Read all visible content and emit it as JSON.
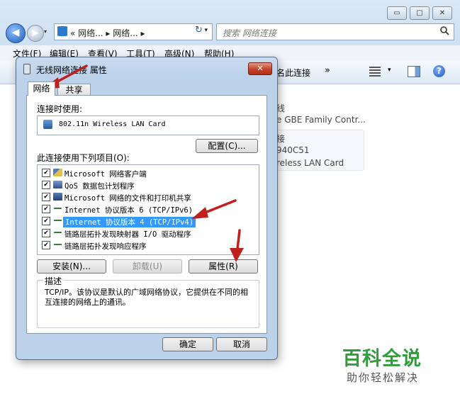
{
  "explorer": {
    "window_buttons": {
      "minimize": "▭",
      "maximize": "▢",
      "close": "✕"
    },
    "nav": {
      "back": "◀",
      "forward": "▶",
      "history": "▾"
    },
    "address_path": "« 网络... ▸ 网络... ▸",
    "address_dropdown": "▾",
    "refresh_icon": "↻",
    "search_placeholder": "搜索 网络连接",
    "menu": [
      "文件(F)",
      "编辑(E)",
      "查看(V)",
      "工具(T)",
      "高级(N)",
      "帮助(H)"
    ],
    "command_bar": {
      "rename": "名此连接",
      "more": "»",
      "view_dropdown": "▾",
      "help": "?"
    },
    "background_text": {
      "line1": "线",
      "line2": "e GBE Family Contr...",
      "line3": "接",
      "line4": "940C51",
      "line5": "reless LAN Card"
    }
  },
  "dialog": {
    "title": "无线网络连接 属性",
    "close": "✕",
    "tabs": {
      "network": "网络",
      "sharing": "共享"
    },
    "connect_using_label": "连接时使用:",
    "device_name": "802.11n Wireless LAN Card",
    "configure_button": "配置(C)...",
    "items_label": "此连接使用下列项目(O):",
    "items": [
      {
        "label": "Microsoft 网络客户端",
        "checked": true,
        "icon": "network-client-icon"
      },
      {
        "label": "QoS 数据包计划程序",
        "checked": true,
        "icon": "qos-icon"
      },
      {
        "label": "Microsoft 网络的文件和打印机共享",
        "checked": true,
        "icon": "file-share-icon"
      },
      {
        "label": "Internet 协议版本 6 (TCP/IPv6)",
        "checked": true,
        "icon": "protocol-icon"
      },
      {
        "label": "Internet 协议版本 4 (TCP/IPv4)",
        "checked": true,
        "icon": "protocol-icon",
        "selected": true
      },
      {
        "label": "链路层拓扑发现映射器 I/O 驱动程序",
        "checked": true,
        "icon": "protocol-icon"
      },
      {
        "label": "链路层拓扑发现响应程序",
        "checked": true,
        "icon": "protocol-icon"
      }
    ],
    "checkmark": "✔",
    "install_button": "安装(N)...",
    "uninstall_button": "卸载(U)",
    "properties_button": "属性(R)",
    "description_legend": "描述",
    "description_text": "TCP/IP。该协议是默认的广域网络协议，它提供在不同的相互连接的网络上的通讯。",
    "ok_button": "确定",
    "cancel_button": "取消"
  },
  "watermark": {
    "title": "百科全说",
    "subtitle": "助你轻松解决"
  },
  "colors": {
    "selection": "#3399ff",
    "arrow": "#c0201c",
    "watermark_green": "#2f9e3a"
  }
}
